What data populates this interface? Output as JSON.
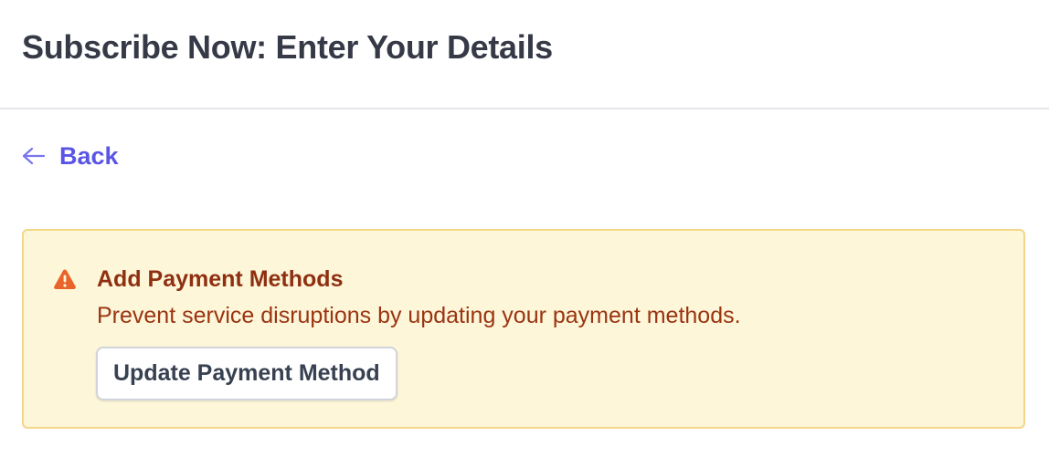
{
  "header": {
    "title": "Subscribe Now: Enter Your Details"
  },
  "nav": {
    "back_label": "Back",
    "back_icon": "arrow-left-icon"
  },
  "alert": {
    "icon": "warning-triangle-icon",
    "title": "Add Payment Methods",
    "message": "Prevent service disruptions by updating your payment methods.",
    "button_label": "Update Payment Method"
  },
  "colors": {
    "accent": "#5a55e6",
    "alert_background": "#fdf6d8",
    "alert_border": "#f3d68a",
    "alert_text": "#9a3412",
    "warning_icon": "#e8642a",
    "title_text": "#363a47"
  }
}
